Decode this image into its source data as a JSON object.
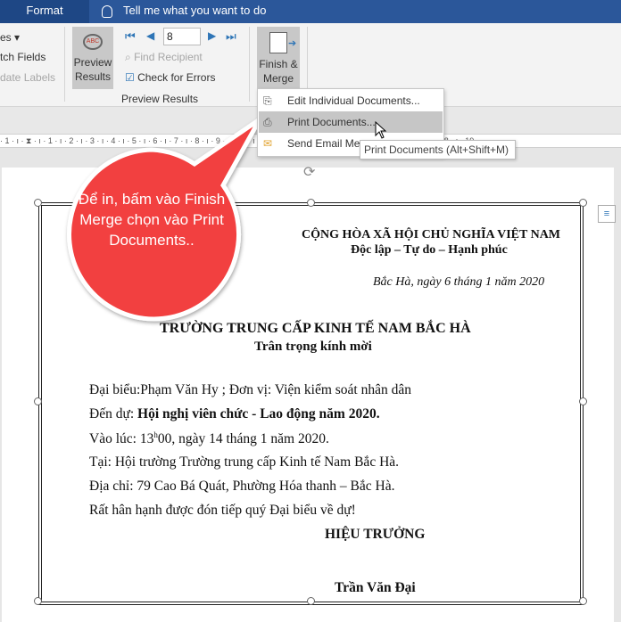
{
  "titlebar": {
    "tab_format": "Format",
    "tell_me": "Tell me what you want to do"
  },
  "ribbon": {
    "left_items": [
      "es",
      "tch Fields",
      "date Labels"
    ],
    "preview_results_button": "Preview Results",
    "record_number": "8",
    "find_recipient": "Find Recipient",
    "check_for_errors": "Check for Errors",
    "group_label": "Preview Results",
    "finish_merge_button": "Finish & Merge"
  },
  "menu": {
    "items": [
      {
        "label": "Edit Individual Documents...",
        "icon": "edit-documents-icon"
      },
      {
        "label": "Print Documents...",
        "icon": "print-documents-icon",
        "highlighted": true
      },
      {
        "label": "Send Email Messages...",
        "icon": "send-email-icon"
      }
    ]
  },
  "tooltip": "Print Documents (Alt+Shift+M)",
  "ruler": {
    "text": "· 1 · ı · ⧗ · ı · 1 · ı · 2 · ı · 3 · ı · 4 · ı · 5 · ı · 6 · ı · 7 · ı · 8 · ı · 9 · ı · 10 · ı · 11 · ı · 12 · ı · 13 · ı · 14 · ı · 15 · ı · 16 · ı · 17 · ı · 18 · ı · 19 ·"
  },
  "callout": {
    "text": "Để in, bấm vào Finish Merge chọn vào Print Documents..",
    "color": "#f2403f"
  },
  "document": {
    "header1": "CỘNG HÒA XÃ HỘI CHỦ NGHĨA VIỆT NAM",
    "header2": "Độc lập – Tự do – Hạnh phúc",
    "date": "Bắc Hà, ngày 6 tháng 1 năm 2020",
    "school": "TRƯỜNG TRUNG CẤP KINH TẾ NAM BẮC HÀ",
    "invite": "Trân trọng kính mời",
    "line1": "Đại biểu:Phạm Văn Hy ; Đơn vị: Viện kiểm soát nhân dân",
    "line2_prefix": "Đến dự: ",
    "line2_bold": "Hội nghị viên chức - Lao động năm 2020.",
    "line3_a": "Vào lúc: 13",
    "line3_sup": "h",
    "line3_b": "00, ngày 14 tháng 1 năm 2020.",
    "line4": "Tại: Hội trường Trường trung cấp Kinh tế Nam Bắc Hà.",
    "line5": "Địa chỉ: 79 Cao Bá Quát, Phường Hóa thanh – Bắc Hà.",
    "line6": "Rất hân hạnh được đón tiếp quý Đại biểu về dự!",
    "sign_title": "HIỆU TRƯỞNG",
    "signer": "Trần Văn Đại"
  }
}
